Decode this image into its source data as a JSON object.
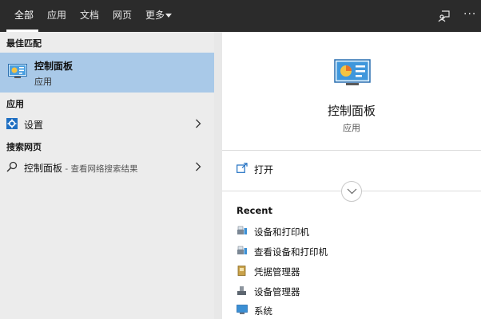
{
  "tabs": [
    {
      "label": "全部",
      "active": true
    },
    {
      "label": "应用"
    },
    {
      "label": "文档"
    },
    {
      "label": "网页"
    },
    {
      "label": "更多"
    }
  ],
  "left": {
    "best_match_header": "最佳匹配",
    "best_match": {
      "title": "控制面板",
      "subtitle": "应用",
      "icon": "control-panel-icon"
    },
    "apps_header": "应用",
    "settings_label": "设置",
    "web_header": "搜索网页",
    "web_result": {
      "query": "控制面板",
      "note": " - 查看网络搜索结果"
    }
  },
  "right": {
    "title": "控制面板",
    "subtitle": "应用",
    "open_label": "打开",
    "recent_header": "Recent",
    "recent": [
      {
        "label": "设备和打印机",
        "icon": "printer-icon"
      },
      {
        "label": "查看设备和打印机",
        "icon": "printer-icon"
      },
      {
        "label": "凭据管理器",
        "icon": "credential-icon"
      },
      {
        "label": "设备管理器",
        "icon": "device-manager-icon"
      },
      {
        "label": "系统",
        "icon": "system-icon"
      }
    ]
  },
  "colors": {
    "topbar": "#2b2b2b",
    "selected": "#a9c9e8",
    "accent": "#1f6fc2"
  }
}
